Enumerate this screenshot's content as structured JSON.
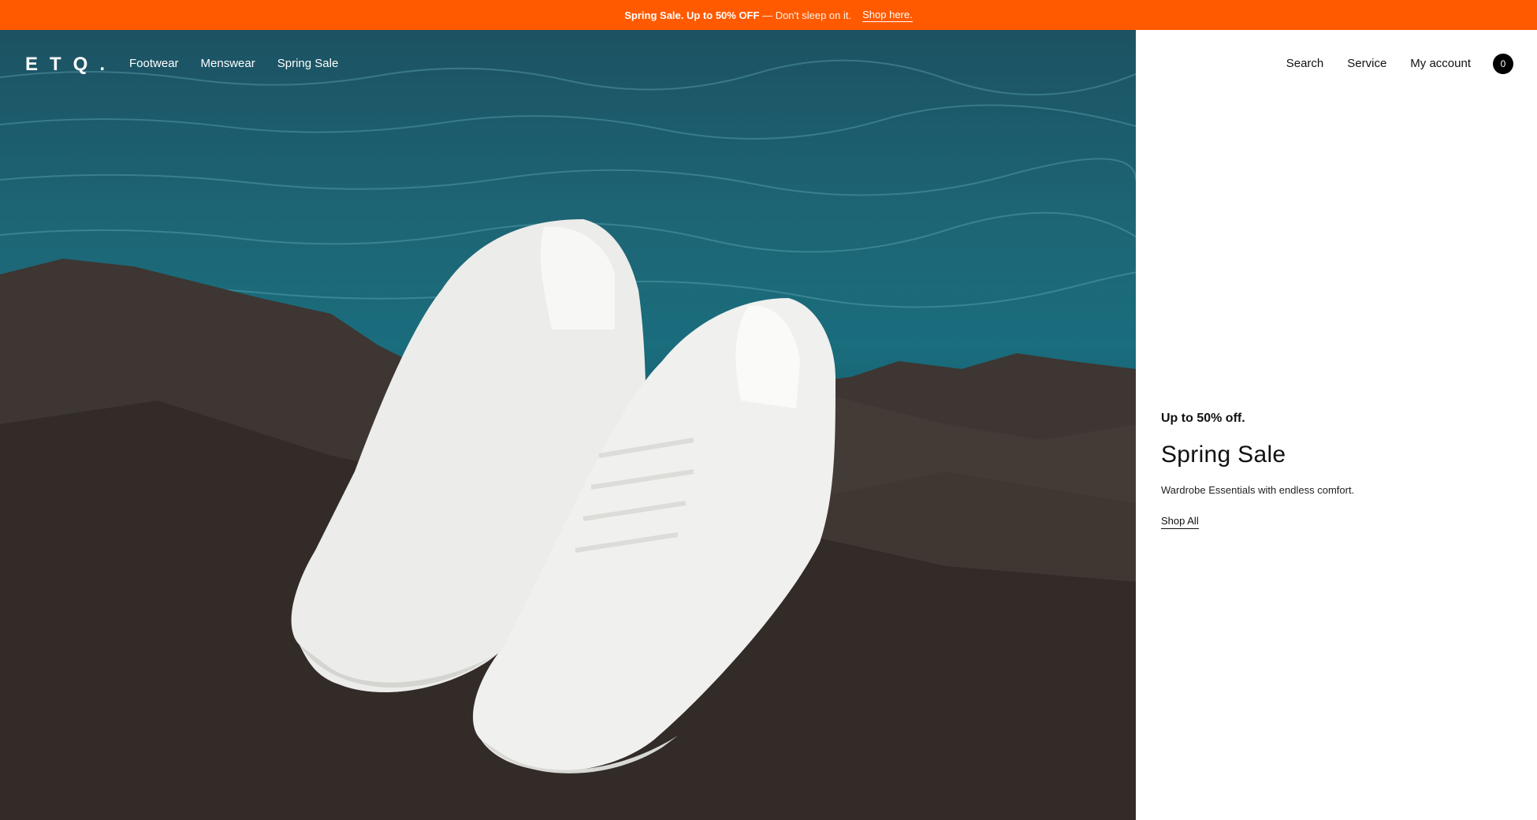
{
  "brand": {
    "accent": "#ff5a00",
    "logo_text": "ETQ."
  },
  "announcement": {
    "bold": "Spring Sale. Up to 50% OFF",
    "rest": "— Don't sleep on it.",
    "link": "Shop here."
  },
  "nav": {
    "items": [
      "Footwear",
      "Menswear",
      "Spring Sale"
    ],
    "utility": [
      "Search",
      "Service",
      "My account"
    ],
    "cart_count": "0"
  },
  "promo": {
    "eyebrow": "Up to 50% off.",
    "title": "Spring Sale",
    "subtitle": "Wardrobe Essentials with endless comfort.",
    "cta": "Shop All"
  },
  "hero": {
    "image": "white-leather-sneakers-on-rock-by-sea"
  }
}
